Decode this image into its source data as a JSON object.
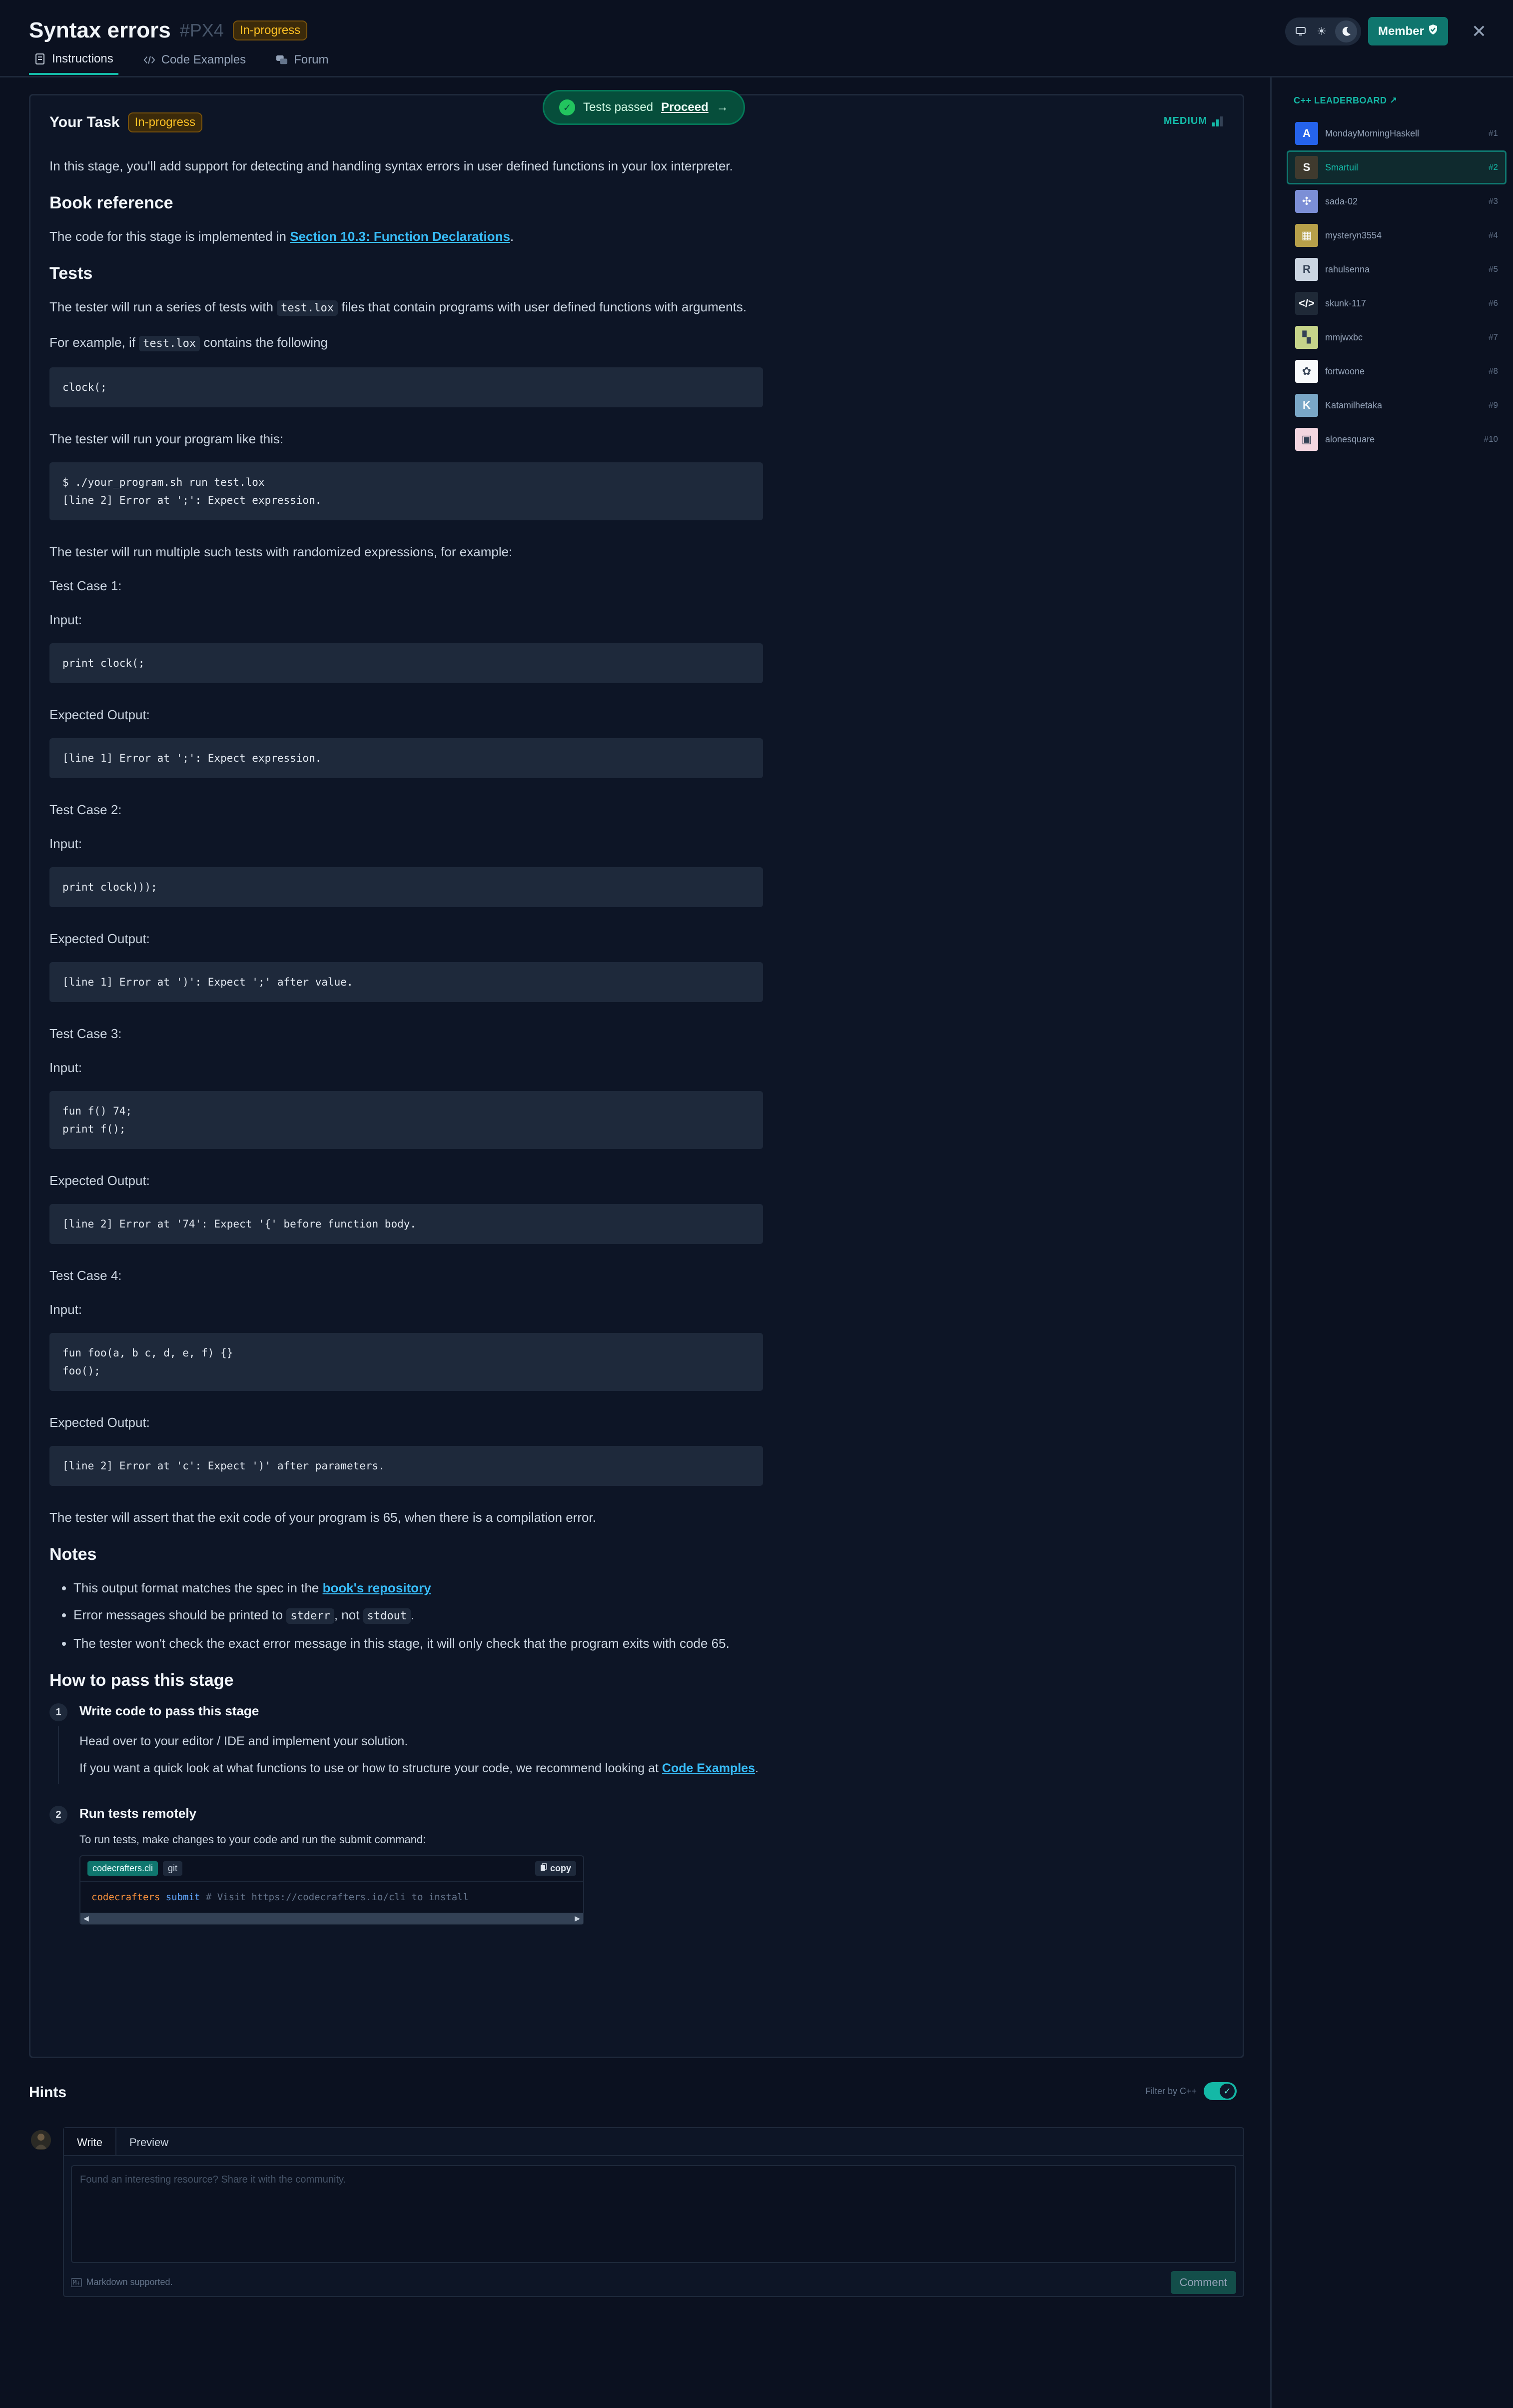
{
  "header": {
    "title": "Syntax errors",
    "code": "#PX4",
    "status": "In-progress",
    "tabs": [
      {
        "label": "Instructions",
        "icon": "document-icon"
      },
      {
        "label": "Code Examples",
        "icon": "code-icon"
      },
      {
        "label": "Forum",
        "icon": "chat-icon"
      }
    ],
    "member_label": "Member"
  },
  "task": {
    "heading": "Your Task",
    "status": "In-progress",
    "difficulty": "MEDIUM",
    "toast_text": "Tests passed",
    "toast_action": "Proceed",
    "intro": "In this stage, you'll add support for detecting and handling syntax errors in user defined functions in your lox interpreter.",
    "book_heading": "Book reference",
    "book_prefix": "The code for this stage is implemented in ",
    "book_link": "Section 10.3: Function Declarations",
    "book_suffix": ".",
    "tests_heading": "Tests",
    "tests_p1_a": "The tester will run a series of tests with ",
    "tests_p1_code": "test.lox",
    "tests_p1_b": " files that contain programs with user defined functions with arguments.",
    "tests_p2_a": "For example, if ",
    "tests_p2_code": "test.lox",
    "tests_p2_b": " contains the following",
    "example_code": "clock(;",
    "run_text": "The tester will run your program like this:",
    "run_code": "$ ./your_program.sh run test.lox\n[line 2] Error at ';': Expect expression.",
    "multi_text": "The tester will run multiple such tests with randomized expressions, for example:",
    "input_label": "Input:",
    "expected_label": "Expected Output:",
    "cases": [
      {
        "title": "Test Case 1:",
        "input": "print clock(;",
        "output": "[line 1] Error at ';': Expect expression."
      },
      {
        "title": "Test Case 2:",
        "input": "print clock)));",
        "output": "[line 1] Error at ')': Expect ';' after value."
      },
      {
        "title": "Test Case 3:",
        "input": "fun f() 74;\nprint f();",
        "output": "[line 2] Error at '74': Expect '{' before function body."
      },
      {
        "title": "Test Case 4:",
        "input": "fun foo(a, b c, d, e, f) {}\nfoo();",
        "output": "[line 2] Error at 'c': Expect ')' after parameters."
      }
    ],
    "exit_text": "The tester will assert that the exit code of your program is 65, when there is a compilation error.",
    "notes_heading": "Notes",
    "note1_a": "This output format matches the spec in the ",
    "note1_link": "book's repository",
    "note2_a": "Error messages should be printed to ",
    "note2_code1": "stderr",
    "note2_b": ", not ",
    "note2_code2": "stdout",
    "note2_c": ".",
    "note3": "The tester won't check the exact error message in this stage, it will only check that the program exits with code 65.",
    "pass_heading": "How to pass this stage",
    "step1_num": "1",
    "step1_title": "Write code to pass this stage",
    "step1_p1": "Head over to your editor / IDE and implement your solution.",
    "step1_p2_a": "If you want a quick look at what functions to use or how to structure your code, we recommend looking at ",
    "step1_p2_link": "Code Examples",
    "step1_p2_b": ".",
    "step2_num": "2",
    "step2_title": "Run tests remotely",
    "step2_p": "To run tests, make changes to your code and run the submit command:",
    "cli_tab1": "codecrafters.cli",
    "cli_tab2": "git",
    "copy_label": "copy",
    "cli_cmd1": "codecrafters",
    "cli_cmd2": "submit",
    "cli_cmd3": "# Visit https://codecrafters.io/cli to install"
  },
  "hints": {
    "title": "Hints",
    "filter_label": "Filter by C++",
    "write_tab": "Write",
    "preview_tab": "Preview",
    "placeholder": "Found an interesting resource? Share it with the community.",
    "markdown_note": "Markdown supported.",
    "comment_label": "Comment"
  },
  "leaderboard": {
    "title": "C++ LEADERBOARD ↗",
    "entries": [
      {
        "name": "MondayMorningHaskell",
        "rank": "#1",
        "color": "#2563eb",
        "glyph": "A"
      },
      {
        "name": "Smartuil",
        "rank": "#2",
        "color": "#3f3a2e",
        "glyph": "S",
        "me": true
      },
      {
        "name": "sada-02",
        "rank": "#3",
        "color": "#7c8fd6",
        "glyph": "✣"
      },
      {
        "name": "mysteryn3554",
        "rank": "#4",
        "color": "#b7a04a",
        "glyph": "▦"
      },
      {
        "name": "rahulsenna",
        "rank": "#5",
        "color": "#cbd5e1",
        "glyph": "R"
      },
      {
        "name": "skunk-117",
        "rank": "#6",
        "color": "#1f2937",
        "glyph": "</>"
      },
      {
        "name": "mmjwxbc",
        "rank": "#7",
        "color": "#c6d48a",
        "glyph": "▚"
      },
      {
        "name": "fortwoone",
        "rank": "#8",
        "color": "#f8fafc",
        "glyph": "✿"
      },
      {
        "name": "Katamilhetaka",
        "rank": "#9",
        "color": "#7aa7c7",
        "glyph": "K"
      },
      {
        "name": "alonesquare",
        "rank": "#10",
        "color": "#f3d6e0",
        "glyph": "▣"
      }
    ]
  }
}
